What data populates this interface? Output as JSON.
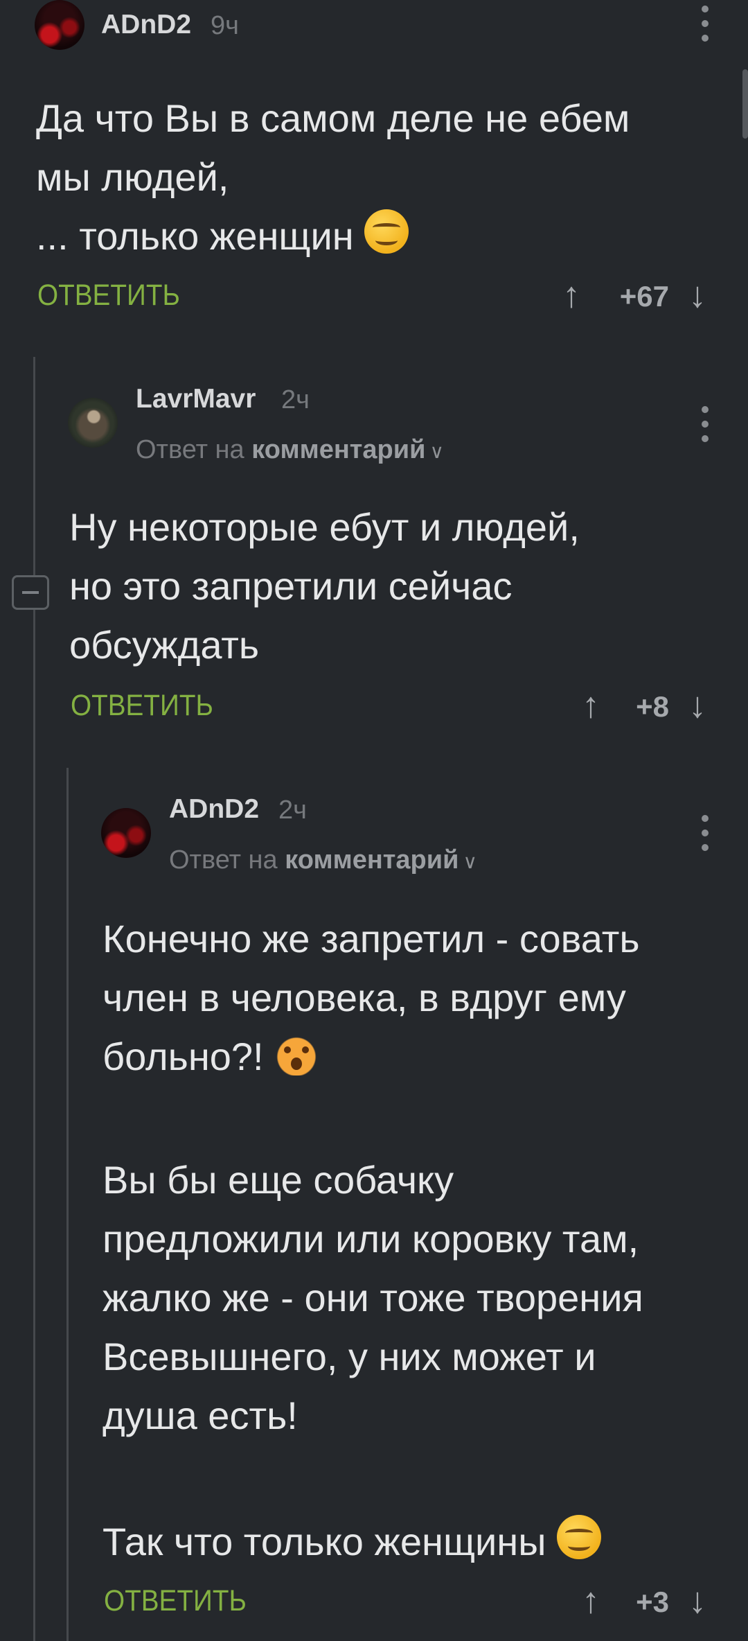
{
  "comments": [
    {
      "author": "ADnD2",
      "time": "9ч",
      "text": "Да что Вы в самом деле не ебем\nмы людей,\n... только женщин",
      "reply_label": "ОТВЕТИТЬ",
      "rating": "+67"
    },
    {
      "author": "LavrMavr",
      "time": "2ч",
      "reply_prefix": "Ответ на",
      "reply_target": "комментарий",
      "text": "Ну некоторые ебут и людей,\nно это запретили сейчас\nобсуждать",
      "reply_label": "ОТВЕТИТЬ",
      "rating": "+8"
    },
    {
      "author": "ADnD2",
      "time": "2ч",
      "reply_prefix": "Ответ на",
      "reply_target": "комментарий",
      "text_p1": "Конечно же запретил - совать\nчлен в человека, в вдруг ему\nбольно?!",
      "text_p2": "Вы бы еще собачку\nпредложили или коровку там,\nжалко же - они тоже творения\nВсевышнего, у них может и\nдуша есть!",
      "text_p3": "Так что только женщины",
      "reply_label": "ОТВЕТИТЬ",
      "rating": "+3"
    }
  ],
  "icons": {
    "upvote": "arrow-up-icon",
    "downvote": "arrow-down-icon",
    "more": "more-vertical-icon",
    "collapse": "collapse-thread-icon",
    "smile_emoji": "smiling-face-icon",
    "cat_emoji": "weary-cat-icon"
  },
  "colors": {
    "background": "#25282c",
    "accent": "#84b142"
  }
}
